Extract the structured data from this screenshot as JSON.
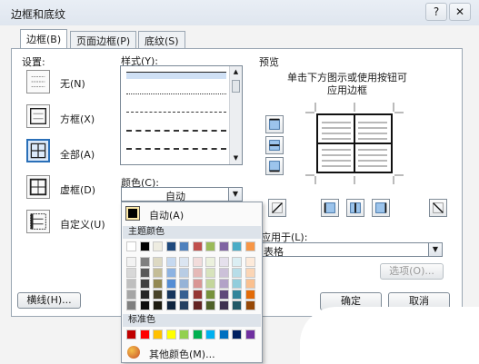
{
  "window": {
    "title": "边框和底纹",
    "help_glyph": "?",
    "close_glyph": "✕"
  },
  "tabs": [
    {
      "label": "边框(B)",
      "active": true
    },
    {
      "label": "页面边框(P)",
      "active": false
    },
    {
      "label": "底纹(S)",
      "active": false
    }
  ],
  "settings": {
    "header": "设置:",
    "items": [
      {
        "label": "无(N)",
        "icon": "none-border-icon"
      },
      {
        "label": "方框(X)",
        "icon": "box-border-icon"
      },
      {
        "label": "全部(A)",
        "icon": "all-borders-icon",
        "selected": true
      },
      {
        "label": "虚框(D)",
        "icon": "grid-border-icon"
      },
      {
        "label": "自定义(U)",
        "icon": "custom-border-icon"
      }
    ]
  },
  "style": {
    "header": "样式(Y):"
  },
  "color": {
    "header": "颜色(C):",
    "value": "自动"
  },
  "preview": {
    "header": "预览",
    "hint_line1": "单击下方图示或使用按钮可",
    "hint_line2": "应用边框"
  },
  "apply_to": {
    "header": "应用于(L):",
    "value": "表格"
  },
  "buttons": {
    "options": "选项(O)...",
    "horizontal_line": "横线(H)...",
    "ok": "确定",
    "cancel": "取消"
  },
  "color_popup": {
    "auto_label": "自动(A)",
    "theme_header": "主题颜色",
    "standard_header": "标准色",
    "more_colors": "其他颜色(M)...",
    "theme_top": [
      "#ffffff",
      "#000000",
      "#eeece1",
      "#1f497d",
      "#4f81bd",
      "#c0504d",
      "#9bbb59",
      "#8064a2",
      "#4bacc6",
      "#f79646"
    ],
    "theme_shades": [
      [
        "#f2f2f2",
        "#7f7f7f",
        "#ddd9c3",
        "#c6d9f0",
        "#dbe5f1",
        "#f2dcdb",
        "#ebf1dd",
        "#e5e0ec",
        "#dbeef3",
        "#fdeada"
      ],
      [
        "#d8d8d8",
        "#595959",
        "#c4bd97",
        "#8db3e2",
        "#b8cce4",
        "#e5b9b7",
        "#d7e3bc",
        "#ccc1d9",
        "#b7dde8",
        "#fbd5b5"
      ],
      [
        "#bfbfbf",
        "#3f3f3f",
        "#938953",
        "#548dd4",
        "#95b3d7",
        "#d99694",
        "#c3d69b",
        "#b2a2c7",
        "#92cddc",
        "#fac08f"
      ],
      [
        "#a5a5a5",
        "#262626",
        "#494429",
        "#17365d",
        "#366092",
        "#953734",
        "#76923c",
        "#5f497a",
        "#31859b",
        "#e36c09"
      ],
      [
        "#7f7f7f",
        "#0c0c0c",
        "#1d1b10",
        "#0f243e",
        "#244061",
        "#632423",
        "#4f6128",
        "#3f3151",
        "#205867",
        "#974806"
      ]
    ],
    "standard": [
      "#c00000",
      "#ff0000",
      "#ffc000",
      "#ffff00",
      "#92d050",
      "#00b050",
      "#00b0f0",
      "#0070c0",
      "#002060",
      "#7030a0"
    ]
  }
}
